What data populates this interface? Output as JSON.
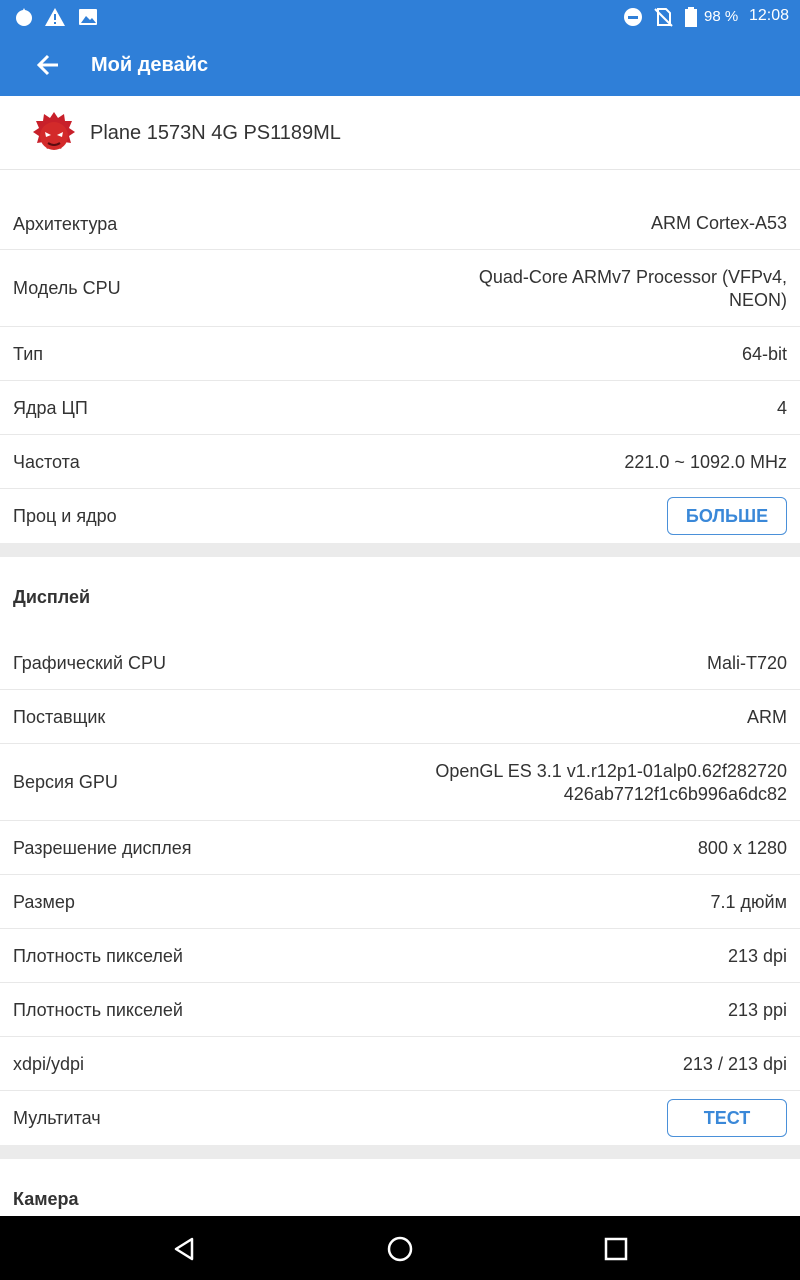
{
  "status_bar": {
    "battery_percent": "98 %",
    "time": "12:08",
    "icons": [
      "fire-icon",
      "warning-icon",
      "image-icon",
      "do-not-disturb-icon",
      "no-sim-icon",
      "battery-icon"
    ]
  },
  "app_bar": {
    "title": "Мой девайс",
    "back_icon": "arrow-back-icon"
  },
  "device": {
    "name": "Plane 1573N 4G PS1189ML",
    "logo_icon": "antutu-logo-icon"
  },
  "cpu": {
    "rows": [
      {
        "label": "Архитектура",
        "value": "ARM Cortex-A53"
      },
      {
        "label": "Модель CPU",
        "value_line1": "Quad-Core ARMv7 Processor (VFPv4,",
        "value_line2": "NEON)"
      },
      {
        "label": "Тип",
        "value": "64-bit"
      },
      {
        "label": "Ядра ЦП",
        "value": "4"
      },
      {
        "label": "Частота",
        "value": "221.0 ~ 1092.0 MHz"
      },
      {
        "label": "Проц и ядро",
        "button": "БОЛЬШЕ"
      }
    ]
  },
  "display": {
    "title": "Дисплей",
    "rows": [
      {
        "label": "Графический CPU",
        "value": "Mali-T720"
      },
      {
        "label": "Поставщик",
        "value": "ARM"
      },
      {
        "label": "Версия GPU",
        "value_line1": "OpenGL ES 3.1 v1.r12p1-01alp0.62f282720",
        "value_line2": "426ab7712f1c6b996a6dc82"
      },
      {
        "label": "Разрешение дисплея",
        "value": "800 x 1280"
      },
      {
        "label": "Размер",
        "value": "7.1 дюйм"
      },
      {
        "label": "Плотность пикселей",
        "value": "213 dpi"
      },
      {
        "label": "Плотность пикселей",
        "value": "213 ppi"
      },
      {
        "label": "xdpi/ydpi",
        "value": "213 / 213 dpi"
      },
      {
        "label": "Мультитач",
        "button": "ТЕСТ"
      }
    ]
  },
  "camera": {
    "title": "Камера"
  },
  "nav_bar": {
    "icons": [
      "nav-back-icon",
      "nav-home-icon",
      "nav-recents-icon"
    ]
  },
  "colors": {
    "accent": "#2f7fd8",
    "button_text": "#3a88d8",
    "divider": "#ebebeb"
  }
}
